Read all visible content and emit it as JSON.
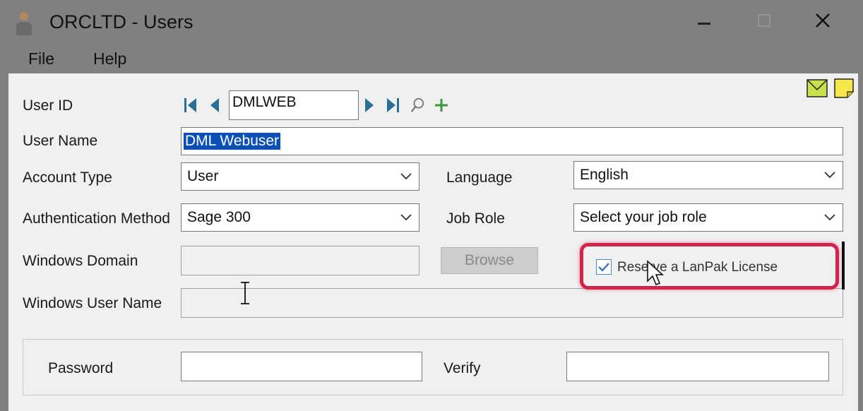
{
  "window": {
    "title": "ORCLTD - Users",
    "controls": {
      "minimize": "minimize-icon",
      "maximize": "maximize-icon",
      "close": "close-icon"
    }
  },
  "menu": [
    {
      "label": "File"
    },
    {
      "label": "Help"
    }
  ],
  "form": {
    "user_id": {
      "label": "User ID",
      "value": "DMLWEB"
    },
    "user_name": {
      "label": "User Name",
      "value": "DML Webuser"
    },
    "account_type": {
      "label": "Account Type",
      "value": "User"
    },
    "language": {
      "label": "Language",
      "value": "English"
    },
    "auth_method": {
      "label": "Authentication Method",
      "value": "Sage 300"
    },
    "job_role": {
      "label": "Job Role",
      "value": "Select your job role"
    },
    "windows_domain": {
      "label": "Windows Domain",
      "value": ""
    },
    "browse_button": "Browse",
    "lanpak": {
      "label": "Reserve a LanPak License",
      "checked": true
    },
    "windows_user_name": {
      "label": "Windows User Name",
      "value": ""
    },
    "password": {
      "label": "Password",
      "value": ""
    },
    "verify": {
      "label": "Verify",
      "value": ""
    }
  },
  "colors": {
    "accent_highlight": "#d2234c",
    "selection": "#0a4fb5",
    "nav_arrow": "#2a6f97",
    "add_icon": "#3a9a3a"
  }
}
